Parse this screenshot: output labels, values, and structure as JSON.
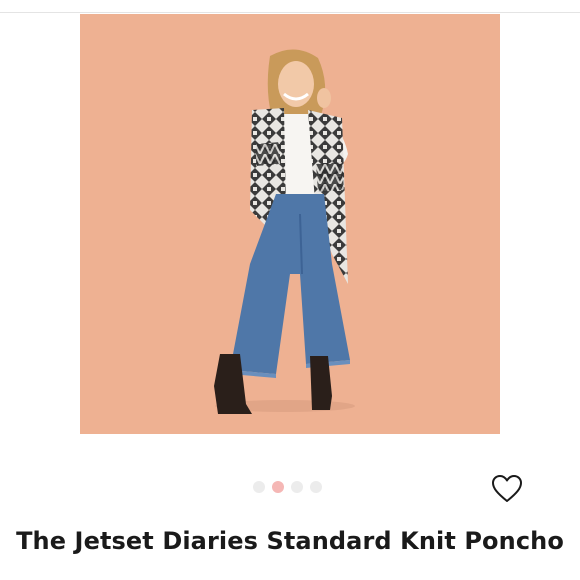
{
  "listing": {
    "title": "The Jetset Diaries Standard Knit Poncho",
    "image": {
      "background_color": "#eeb192",
      "subject": "model-in-knit-poncho-photo"
    },
    "carousel": {
      "count": 4,
      "active_index": 1,
      "active_color": "#f5b7b5",
      "inactive_color": "#ececec"
    },
    "like_icon": "heart-outline-icon"
  }
}
